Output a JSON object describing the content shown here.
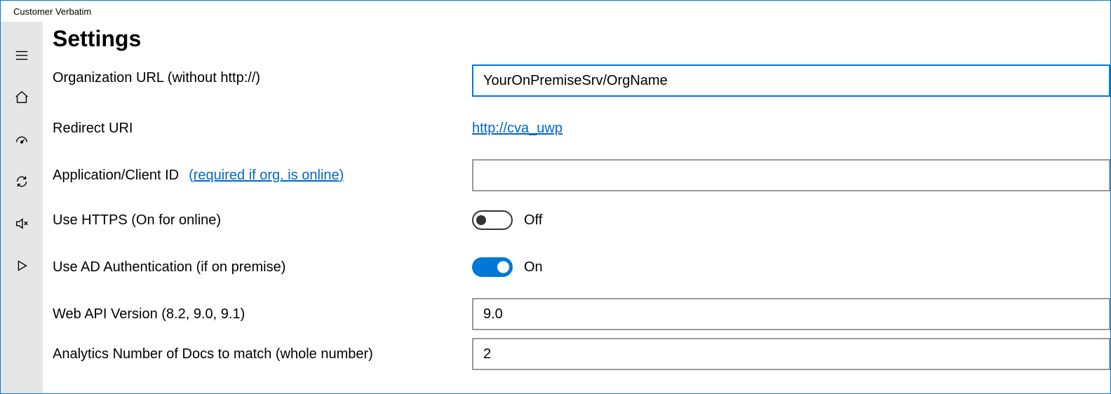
{
  "window": {
    "title": "Customer Verbatim"
  },
  "page": {
    "title": "Settings"
  },
  "fields": {
    "org_url": {
      "label": "Organization URL (without http://)",
      "value": "YourOnPremiseSrv/OrgName"
    },
    "redirect": {
      "label": "Redirect URI",
      "link_text": "http://cva_uwp"
    },
    "client_id": {
      "label": "Application/Client ID",
      "hint_link": "(required if org. is online)",
      "value": ""
    },
    "https": {
      "label": "Use HTTPS (On for online)",
      "state_label": "Off"
    },
    "adauth": {
      "label": "Use AD Authentication (if on premise)",
      "state_label": "On"
    },
    "apiver": {
      "label": "Web API Version (8.2, 9.0, 9.1)",
      "value": "9.0"
    },
    "docs": {
      "label": "Analytics Number of Docs to match (whole number)",
      "value": "2"
    }
  }
}
